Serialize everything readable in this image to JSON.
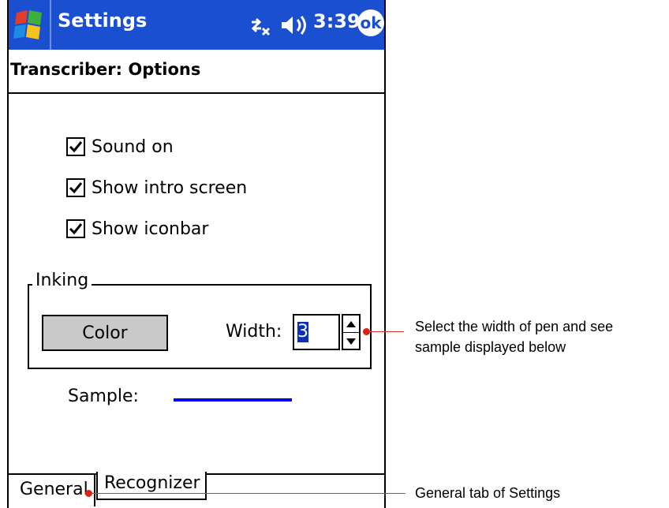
{
  "titlebar": {
    "title": "Settings",
    "time": "3:39",
    "ok_label": "ok"
  },
  "page": {
    "heading": "Transcriber: Options"
  },
  "options": [
    {
      "label": "Sound on",
      "checked": true
    },
    {
      "label": "Show intro screen",
      "checked": true
    },
    {
      "label": "Show iconbar",
      "checked": true
    }
  ],
  "inking": {
    "group_label": "Inking",
    "color_button": "Color",
    "width_label": "Width:",
    "width_value": "3",
    "sample_label": "Sample:",
    "sample_color": "#0000e6"
  },
  "tabs": [
    {
      "label": "General",
      "active": true
    },
    {
      "label": "Recognizer",
      "active": false
    }
  ],
  "annotations": {
    "width_note_line1": "Select the width of pen and see",
    "width_note_line2": "sample displayed below",
    "tab_note": "General tab of Settings",
    "color": "#d22222"
  },
  "icons": {
    "start": "windows-flag-icon",
    "connectivity": "connectivity-icon",
    "volume": "speaker-icon"
  }
}
